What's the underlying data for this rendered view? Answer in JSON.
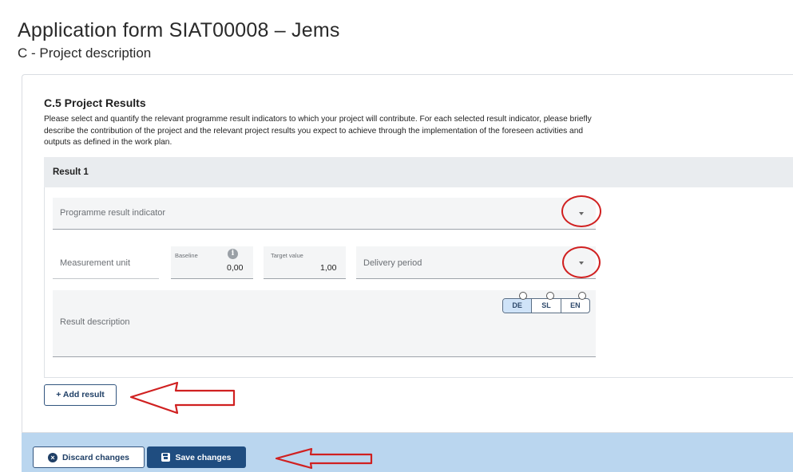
{
  "page": {
    "title": "Application form SIAT00008 – Jems",
    "subtitle": "C - Project description"
  },
  "section": {
    "title": "C.5 Project Results",
    "description": "Please select and quantify the relevant programme result indicators to which your project will contribute. For each selected result indicator, please briefly describe the contribution of the project and the relevant project results you expect to achieve through the implementation of the foreseen activities and outputs as defined in the work plan."
  },
  "result": {
    "header": "Result 1",
    "indicator_placeholder": "Programme result indicator",
    "measurement_unit_label": "Measurement unit",
    "baseline_label": "Baseline",
    "baseline_value": "0,00",
    "target_label": "Target value",
    "target_value": "1,00",
    "delivery_period_placeholder": "Delivery period",
    "description_placeholder": "Result description",
    "languages": [
      "DE",
      "SL",
      "EN"
    ],
    "active_language": "DE"
  },
  "buttons": {
    "add_result": "+ Add result",
    "discard": "Discard changes",
    "save": "Save changes"
  },
  "icons": {
    "info": "i",
    "discard": "×"
  },
  "colors": {
    "primary": "#1f4d80",
    "footer_bar": "#bad6ef",
    "annotation_red": "#d02020",
    "active_language": "#cfe3f8"
  }
}
